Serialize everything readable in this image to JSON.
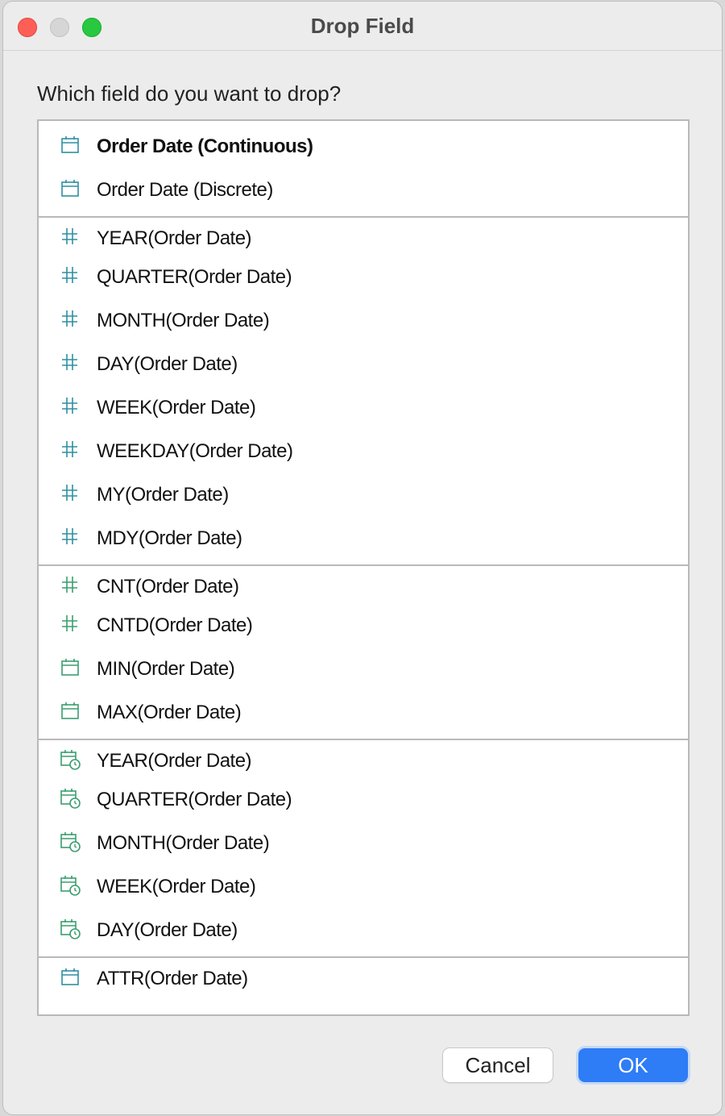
{
  "window": {
    "title": "Drop Field"
  },
  "prompt": "Which field do you want to drop?",
  "colors": {
    "accent": "#2e7cf6",
    "icon_teal": "#2e8fa0",
    "icon_green": "#3a9e6f"
  },
  "fields": [
    {
      "label": "Order Date (Continuous)",
      "icon": "calendar-icon",
      "selected": true
    },
    {
      "label": "Order Date (Discrete)",
      "icon": "calendar-icon"
    },
    {
      "label": "YEAR(Order Date)",
      "icon": "hash-icon"
    },
    {
      "label": "QUARTER(Order Date)",
      "icon": "hash-icon"
    },
    {
      "label": "MONTH(Order Date)",
      "icon": "hash-icon"
    },
    {
      "label": "DAY(Order Date)",
      "icon": "hash-icon"
    },
    {
      "label": "WEEK(Order Date)",
      "icon": "hash-icon"
    },
    {
      "label": "WEEKDAY(Order Date)",
      "icon": "hash-icon"
    },
    {
      "label": "MY(Order Date)",
      "icon": "hash-icon"
    },
    {
      "label": "MDY(Order Date)",
      "icon": "hash-icon"
    },
    {
      "label": "CNT(Order Date)",
      "icon": "hash-green-icon"
    },
    {
      "label": "CNTD(Order Date)",
      "icon": "hash-green-icon"
    },
    {
      "label": "MIN(Order Date)",
      "icon": "calendar-green-icon"
    },
    {
      "label": "MAX(Order Date)",
      "icon": "calendar-green-icon"
    },
    {
      "label": "YEAR(Order Date)",
      "icon": "calendar-clock-icon"
    },
    {
      "label": "QUARTER(Order Date)",
      "icon": "calendar-clock-icon"
    },
    {
      "label": "MONTH(Order Date)",
      "icon": "calendar-clock-icon"
    },
    {
      "label": "WEEK(Order Date)",
      "icon": "calendar-clock-icon"
    },
    {
      "label": "DAY(Order Date)",
      "icon": "calendar-clock-icon"
    },
    {
      "label": "ATTR(Order Date)",
      "icon": "calendar-icon"
    }
  ],
  "buttons": {
    "cancel": "Cancel",
    "ok": "OK"
  }
}
